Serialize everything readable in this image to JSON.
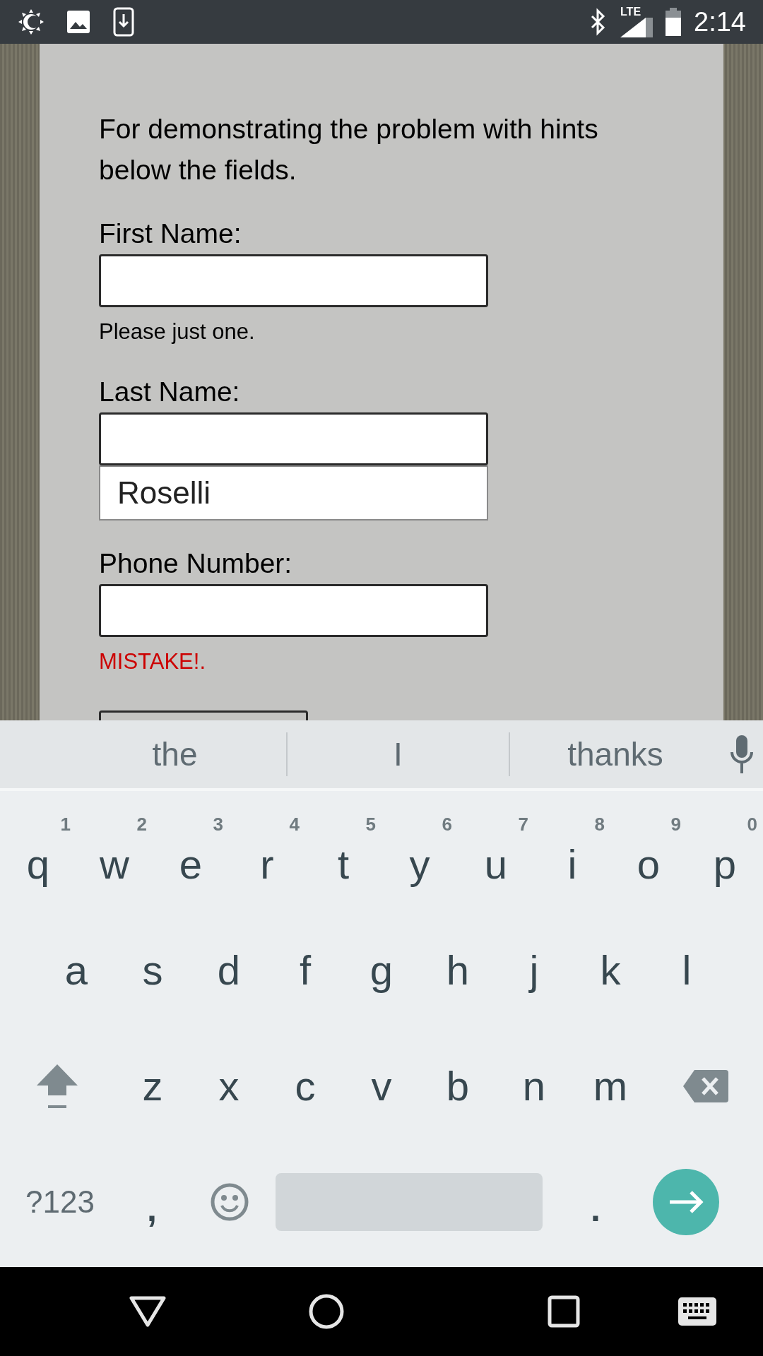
{
  "status_bar": {
    "time": "2:14",
    "network": "LTE"
  },
  "form": {
    "intro": "For demonstrating the problem with hints below the fields.",
    "fields": [
      {
        "label": "First Name:",
        "hint": "Please just one.",
        "kind": "hint"
      },
      {
        "label": "Last Name:",
        "autofill": "Roselli",
        "kind": "autofill"
      },
      {
        "label": "Phone Number:",
        "hint": "MISTAKE!.",
        "kind": "error"
      }
    ]
  },
  "keyboard": {
    "suggestions": [
      "the",
      "I",
      "thanks"
    ],
    "rows": [
      [
        {
          "label": "q",
          "hint": "1"
        },
        {
          "label": "w",
          "hint": "2"
        },
        {
          "label": "e",
          "hint": "3"
        },
        {
          "label": "r",
          "hint": "4"
        },
        {
          "label": "t",
          "hint": "5"
        },
        {
          "label": "y",
          "hint": "6"
        },
        {
          "label": "u",
          "hint": "7"
        },
        {
          "label": "i",
          "hint": "8"
        },
        {
          "label": "o",
          "hint": "9"
        },
        {
          "label": "p",
          "hint": "0"
        }
      ],
      [
        {
          "label": "a"
        },
        {
          "label": "s"
        },
        {
          "label": "d"
        },
        {
          "label": "f"
        },
        {
          "label": "g"
        },
        {
          "label": "h"
        },
        {
          "label": "j"
        },
        {
          "label": "k"
        },
        {
          "label": "l"
        }
      ],
      [
        {
          "label": "z"
        },
        {
          "label": "x"
        },
        {
          "label": "c"
        },
        {
          "label": "v"
        },
        {
          "label": "b"
        },
        {
          "label": "n"
        },
        {
          "label": "m"
        }
      ]
    ],
    "symbols_key": "?123",
    "comma_key": ",",
    "period_key": "."
  }
}
